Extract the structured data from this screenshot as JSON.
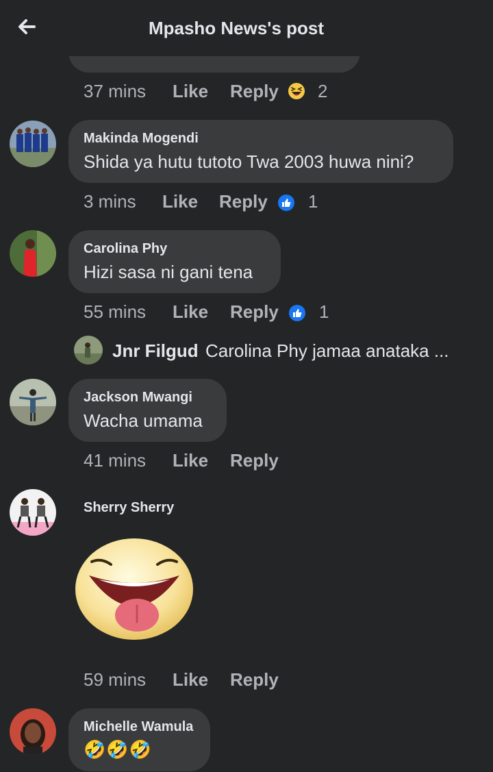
{
  "header": {
    "title": "Mpasho News's post"
  },
  "comments": [
    {
      "time": "37 mins",
      "like": "Like",
      "reply": "Reply",
      "reaction_count": "2",
      "reaction": "laughing-squint-emoji"
    },
    {
      "name": "Makinda Mogendi",
      "text": "Shida ya hutu tutoto Twa 2003 huwa nini?",
      "time": "3 mins",
      "like": "Like",
      "reply": "Reply",
      "reaction_count": "1",
      "reaction": "thumbs-up"
    },
    {
      "name": "Carolina Phy",
      "text": "Hizi sasa ni gani tena",
      "time": "55 mins",
      "like": "Like",
      "reply": "Reply",
      "reaction_count": "1",
      "reaction": "thumbs-up"
    },
    {
      "name": "Jackson Mwangi",
      "text": "Wacha umama",
      "time": "41 mins",
      "like": "Like",
      "reply": "Reply"
    },
    {
      "name": "Sherry Sherry",
      "sticker": "tongue-out-smiley-sticker",
      "time": "59 mins",
      "like": "Like",
      "reply": "Reply"
    },
    {
      "name": "Michelle Wamula",
      "text": "🤣🤣🤣"
    }
  ],
  "reply_preview": {
    "name": "Jnr Filgud",
    "text": "Carolina Phy jamaa anataka ..."
  },
  "colors": {
    "background": "#242526",
    "bubble": "#3a3b3c",
    "text": "#e4e6eb",
    "meta": "#b0b3b8",
    "like_blue": "#1877f2"
  }
}
